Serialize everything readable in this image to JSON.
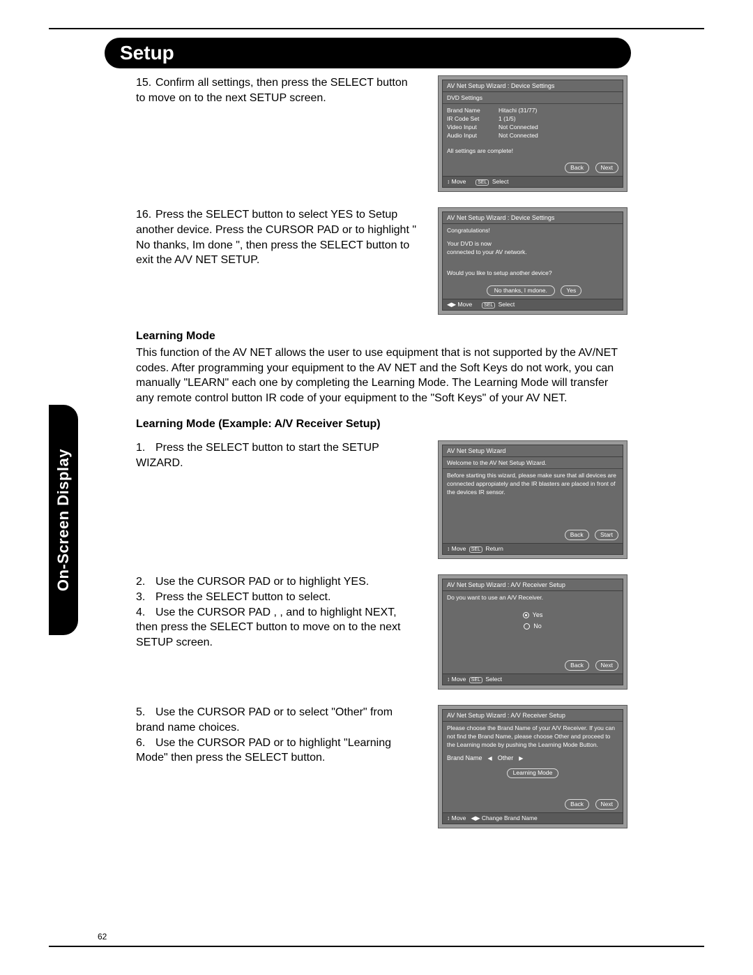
{
  "page_number": "62",
  "header": "Setup",
  "side_tab": "On-Screen Display",
  "steps_top": [
    {
      "num": "15.",
      "text": "Confirm all settings, then  press the SELECT button to move on to the next SETUP screen."
    },
    {
      "num": "16.",
      "text": "Press the SELECT button to select YES to Setup another device.  Press the CURSOR PAD     or     to highlight \" No thanks, Im done \", then press the SELECT button to exit the A/V NET SETUP."
    }
  ],
  "learning_mode_heading": "Learning Mode",
  "learning_mode_para": "This function of the AV NET allows the user to  use equipment that is not supported by the AV/NET codes.  After programming your equipment to the AV NET and the Soft Keys do not work, you can manually \"LEARN\" each one by completing the Learning Mode.  The Learning Mode will transfer any remote control button IR code of your equipment to the \"Soft Keys\" of your AV NET.",
  "example_heading": "Learning Mode (Example: A/V Receiver Setup)",
  "steps_ex": [
    {
      "num": "1.",
      "text": "Press the SELECT button to start the SETUP WIZARD."
    },
    {
      "num": "2.",
      "text": "Use the CURSOR PAD     or     to highlight YES."
    },
    {
      "num": "3.",
      "text": "Press the SELECT button to select."
    },
    {
      "num": "4.",
      "text": "Use the CURSOR PAD    ,    ,     and     to highlight NEXT, then press the SELECT button to move on to the next SETUP screen."
    },
    {
      "num": "5.",
      "text": "Use the CURSOR PAD      or      to select \"Other\" from brand name choices."
    },
    {
      "num": "6.",
      "text": "Use the CURSOR PAD      or      to highlight \"Learning Mode\" then press the SELECT button."
    }
  ],
  "osd1": {
    "title": "AV Net Setup Wizard : Device Settings",
    "sub": "DVD Settings",
    "rows": [
      {
        "k": "Brand Name",
        "v": "Hitachi       (31/77)"
      },
      {
        "k": "IR Code Set",
        "v": "1     (1/5)"
      },
      {
        "k": "Video Input",
        "v": "Not Connected"
      },
      {
        "k": "Audio Input",
        "v": "Not Connected"
      }
    ],
    "msg": "All settings are complete!",
    "btn_left": "Back",
    "btn_right": "Next",
    "foot": "↕ Move        SEL Select"
  },
  "osd2": {
    "title": "AV Net Setup Wizard : Device Settings",
    "msg1": "Congratulations!",
    "msg2": "Your DVD is now\nconnected to your AV network.",
    "msg3": "Would you like to setup another device?",
    "btn_left": "No thanks, I mdone.",
    "btn_right": "Yes",
    "foot": "◀▶ Move        SEL Select"
  },
  "osd3": {
    "title": "AV Net Setup Wizard",
    "sub": "Welcome to the AV Net Setup Wizard.",
    "msg": "Before starting this wizard, please make sure that all devices are connected appropiately and the IR blasters are placed in front of the devices IR sensor.",
    "btn_left": "Back",
    "btn_right": "Start",
    "foot": "↕ Move  SEL Return"
  },
  "osd4": {
    "title": "AV Net Setup Wizard : A/V Receiver Setup",
    "msg": "Do you want to use an A/V Receiver.",
    "opt_yes": "Yes",
    "opt_no": "No",
    "btn_left": "Back",
    "btn_right": "Next",
    "foot": "↕ Move  SEL Select"
  },
  "osd5": {
    "title": "AV Net Setup Wizard : A/V Receiver Setup",
    "msg": "Please choose the Brand Name of your A/V Receiver. If you can not find the Brand Name, please choose  Other  and proceed to the Learning mode by pushing the Learning Mode Button.",
    "brand_label": "Brand Name",
    "brand_value": "Other",
    "learn_btn": "Learning Mode",
    "btn_left": "Back",
    "btn_right": "Next",
    "foot": "↕ Move    ◀▶ Change Brand Name"
  }
}
